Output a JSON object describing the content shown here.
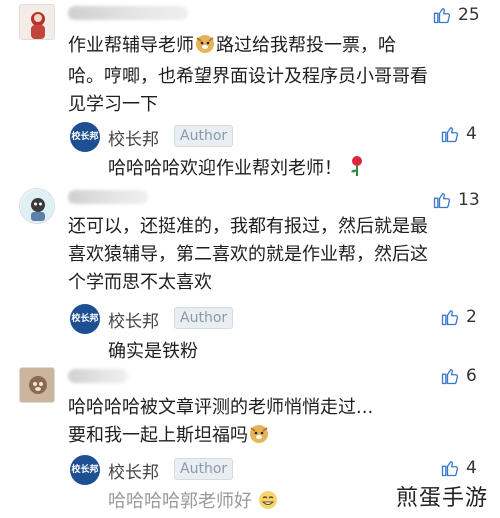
{
  "comments": [
    {
      "likes": "25",
      "text_line1": "作业帮辅导老师",
      "text_line1b": "路过给我帮投一票，哈",
      "text_line2": "哈。哼唧，也希望界面设计及程序员小哥哥看",
      "text_line3": "见学习一下",
      "reply": {
        "author": "校长邦",
        "badge": "Author",
        "avatar_text": "校长邦",
        "likes": "4",
        "text": "哈哈哈哈欢迎作业帮刘老师！"
      }
    },
    {
      "likes": "13",
      "text_line1": "还可以，还挺准的，我都有报过，然后就是最",
      "text_line2": "喜欢猿辅导，第二喜欢的就是作业帮，然后这",
      "text_line3": "个学而思不太喜欢",
      "reply": {
        "author": "校长邦",
        "badge": "Author",
        "avatar_text": "校长邦",
        "likes": "2",
        "text": "确实是铁粉"
      }
    },
    {
      "likes": "6",
      "text_line1": "哈哈哈哈被文章评测的老师悄悄走过...",
      "text_line2": "要和我一起上斯坦福吗",
      "reply": {
        "author": "校长邦",
        "badge": "Author",
        "avatar_text": "校长邦",
        "likes": "4",
        "text": "哈哈哈哈郭老师好"
      }
    }
  ],
  "watermark": "煎蛋手游",
  "colors": {
    "badge_bg": "#e9eef3",
    "badge_text": "#8a99a8",
    "reply_avatar": "#1f4f93"
  }
}
